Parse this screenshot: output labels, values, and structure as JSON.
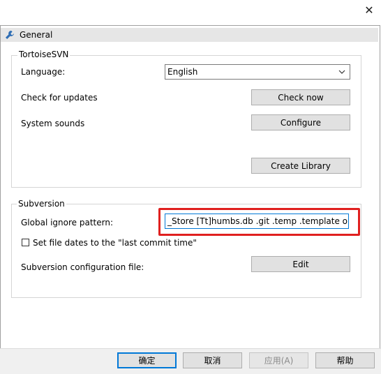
{
  "window": {
    "close_icon": "close-icon"
  },
  "page": {
    "title": "General",
    "icon": "wrench-icon"
  },
  "tortoisesvn": {
    "group_label": "TortoiseSVN",
    "language_label": "Language:",
    "language_value": "English",
    "check_updates_label": "Check for updates",
    "check_now_button": "Check now",
    "system_sounds_label": "System sounds",
    "configure_button": "Configure",
    "create_library_button": "Create Library"
  },
  "subversion": {
    "group_label": "Subversion",
    "ignore_label": "Global ignore pattern:",
    "ignore_value": "_Store [Tt]humbs.db .git .temp .template out",
    "set_dates_label": "Set file dates to the \"last commit time\"",
    "set_dates_checked": false,
    "config_file_label": "Subversion configuration file:",
    "edit_button": "Edit"
  },
  "dialog_buttons": {
    "ok": "确定",
    "cancel": "取消",
    "apply": "应用(A)",
    "help": "帮助"
  },
  "colors": {
    "highlight": "#e0201f",
    "focus": "#0078d7"
  }
}
